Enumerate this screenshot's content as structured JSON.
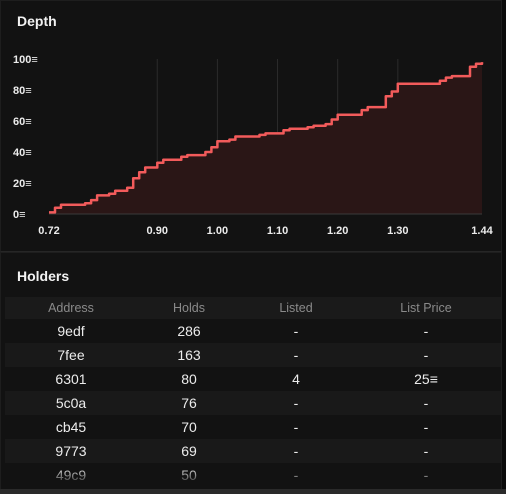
{
  "depth": {
    "title": "Depth",
    "currency_icon": "≡",
    "y_ticks": [
      "100≡",
      "80≡",
      "60≡",
      "40≡",
      "20≡",
      "0≡"
    ],
    "x_ticks": [
      "0.72",
      "0.90",
      "1.00",
      "1.10",
      "1.20",
      "1.30",
      "1.44"
    ],
    "colors": {
      "line": "#f25b5b",
      "fill": "#2a1616",
      "grid": "#2b2b2b"
    }
  },
  "chart_data": {
    "type": "area",
    "title": "Depth",
    "xlabel": "",
    "ylabel": "",
    "xlim": [
      0.72,
      1.44
    ],
    "ylim": [
      0,
      100
    ],
    "grid": true,
    "x": [
      0.72,
      0.73,
      0.74,
      0.78,
      0.79,
      0.8,
      0.82,
      0.83,
      0.85,
      0.86,
      0.87,
      0.88,
      0.9,
      0.91,
      0.94,
      0.95,
      0.98,
      0.99,
      1.0,
      1.02,
      1.03,
      1.07,
      1.08,
      1.11,
      1.12,
      1.15,
      1.16,
      1.18,
      1.19,
      1.2,
      1.24,
      1.25,
      1.28,
      1.29,
      1.3,
      1.37,
      1.38,
      1.39,
      1.42,
      1.43,
      1.44
    ],
    "y": [
      1,
      4,
      6,
      7,
      9,
      12,
      13,
      15,
      17,
      23,
      27,
      30,
      33,
      35,
      37,
      38,
      40,
      43,
      47,
      48,
      50,
      51,
      52,
      54,
      55,
      56,
      57,
      58,
      61,
      64,
      67,
      69,
      76,
      79,
      84,
      86,
      88,
      89,
      95,
      97,
      98
    ]
  },
  "holders": {
    "title": "Holders",
    "columns": [
      "Address",
      "Holds",
      "Listed",
      "List Price"
    ],
    "rows": [
      [
        "9edf",
        "286",
        "-",
        "-"
      ],
      [
        "7fee",
        "163",
        "-",
        "-"
      ],
      [
        "6301",
        "80",
        "4",
        "25≡"
      ],
      [
        "5c0a",
        "76",
        "-",
        "-"
      ],
      [
        "cb45",
        "70",
        "-",
        "-"
      ],
      [
        "9773",
        "69",
        "-",
        "-"
      ],
      [
        "49c9",
        "50",
        "-",
        "-"
      ]
    ]
  }
}
